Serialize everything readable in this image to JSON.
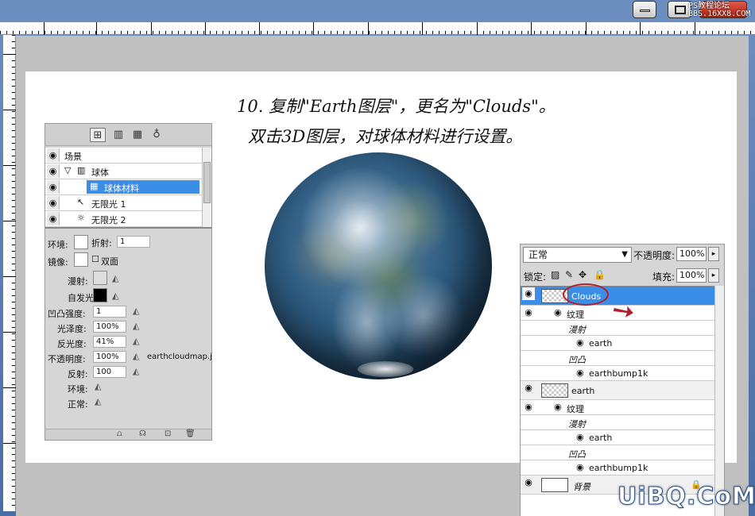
{
  "titlebar": {
    "watermark": "PS教程论坛\nBBS.16XX8.COM"
  },
  "canvas": {
    "note_line1": "10. 复制\"Earth图层\"，更名为\"Clouds\"。",
    "note_line2": "双击3D图层，对球体材料进行设置。"
  },
  "panel3d": {
    "tabs": [
      "scene-icon",
      "mesh-icon",
      "material-icon",
      "light-icon"
    ],
    "scene_items": [
      {
        "label": "场景",
        "icon": "scene-icon"
      },
      {
        "label": "球体",
        "icon": "mesh-icon"
      },
      {
        "label": "球体材料",
        "icon": "material-icon"
      },
      {
        "label": "无限光 1",
        "icon": "infinite-light-icon"
      },
      {
        "label": "无限光 2",
        "icon": "infinite-light-icon"
      }
    ],
    "props": {
      "ambient_label": "环境:",
      "refraction_label": "折射:",
      "refraction_value": "1",
      "mirror_label": "镜像:",
      "double_sided_label": "双面",
      "diffuse_label": "漫射:",
      "self_illum_label": "自发光:",
      "bump_label": "凹凸强度:",
      "bump_value": "1",
      "gloss_label": "光泽度:",
      "gloss_value": "100%",
      "shine_label": "反光度:",
      "shine_value": "41%",
      "opacity_label": "不透明度:",
      "opacity_value": "100%",
      "opacity_map": "earthcloudmap.j",
      "reflect_label": "反射:",
      "reflect_value": "100",
      "env_label": "环境:",
      "normal_label": "正常:"
    }
  },
  "layers": {
    "blend_mode": "正常",
    "opacity_label": "不透明度:",
    "opacity_value": "100%",
    "lock_label": "锁定:",
    "fill_label": "填充:",
    "fill_value": "100%",
    "rows": [
      {
        "name": "Clouds",
        "kind": "layer",
        "selected": true
      },
      {
        "name": "纹理",
        "kind": "group"
      },
      {
        "name": "漫射",
        "kind": "section"
      },
      {
        "name": "earth",
        "kind": "texture"
      },
      {
        "name": "凹凸",
        "kind": "section"
      },
      {
        "name": "earthbump1k",
        "kind": "texture"
      },
      {
        "name": "earth",
        "kind": "layer"
      },
      {
        "name": "纹理",
        "kind": "group"
      },
      {
        "name": "漫射",
        "kind": "section"
      },
      {
        "name": "earth",
        "kind": "texture"
      },
      {
        "name": "凹凸",
        "kind": "section"
      },
      {
        "name": "earthbump1k",
        "kind": "texture"
      },
      {
        "name": "背景",
        "kind": "background"
      }
    ]
  },
  "watermark_bottom": "UiBQ.CoM"
}
